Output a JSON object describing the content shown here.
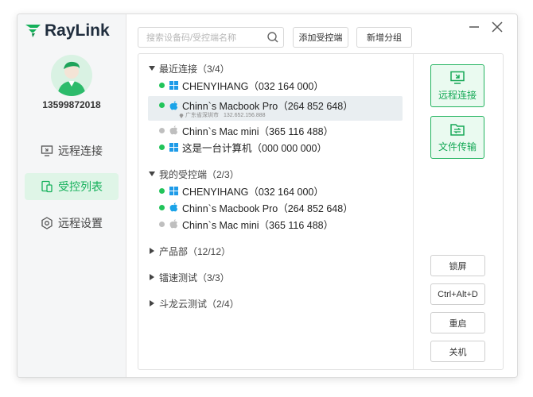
{
  "app": {
    "logo_text": "RayLink"
  },
  "user": {
    "phone": "13599872018"
  },
  "sidebar": {
    "items": [
      {
        "label": "远程连接",
        "icon": "monitor-icon",
        "active": false
      },
      {
        "label": "受控列表",
        "icon": "device-list-icon",
        "active": true
      },
      {
        "label": "远程设置",
        "icon": "settings-icon",
        "active": false
      }
    ]
  },
  "toolbar": {
    "search_placeholder": "搜索设备码/受控端名称",
    "search_value": "",
    "add_controlled_label": "添加受控端",
    "new_group_label": "新增分组"
  },
  "groups": [
    {
      "title": "最近连接（3/4）",
      "expanded": true,
      "devices": [
        {
          "name": "CHENYIHANG（032 164 000）",
          "os": "windows",
          "online": true
        },
        {
          "name": "Chinn`s Macbook Pro（264 852 648）",
          "os": "apple",
          "online": true,
          "selected": true,
          "location": "广东省深圳市",
          "ip": "132.652.156.888"
        },
        {
          "name": "Chinn`s Mac mini（365 116 488）",
          "os": "apple",
          "online": false
        },
        {
          "name": "这是一台计算机（000 000 000）",
          "os": "windows",
          "online": true
        }
      ]
    },
    {
      "title": "我的受控端（2/3）",
      "expanded": true,
      "devices": [
        {
          "name": "CHENYIHANG（032 164 000）",
          "os": "windows",
          "online": true
        },
        {
          "name": "Chinn`s Macbook Pro（264 852 648）",
          "os": "apple",
          "online": true
        },
        {
          "name": "Chinn`s Mac mini（365 116 488）",
          "os": "apple",
          "online": false
        }
      ]
    },
    {
      "title": "产品部（12/12）",
      "expanded": false
    },
    {
      "title": "镭速测试（3/3）",
      "expanded": false
    },
    {
      "title": "斗龙云测试（2/4）",
      "expanded": false
    }
  ],
  "actions": {
    "remote_connect_label": "远程连接",
    "file_transfer_label": "文件传输",
    "lock_screen_label": "锁屏",
    "ctrl_alt_del_label": "Ctrl+Alt+D",
    "restart_label": "重启",
    "shutdown_label": "关机"
  },
  "colors": {
    "accent": "#14b05a",
    "online": "#22c45a",
    "offline": "#bfbfbf",
    "windows": "#1e9be8",
    "apple": "#1aa3e8"
  }
}
